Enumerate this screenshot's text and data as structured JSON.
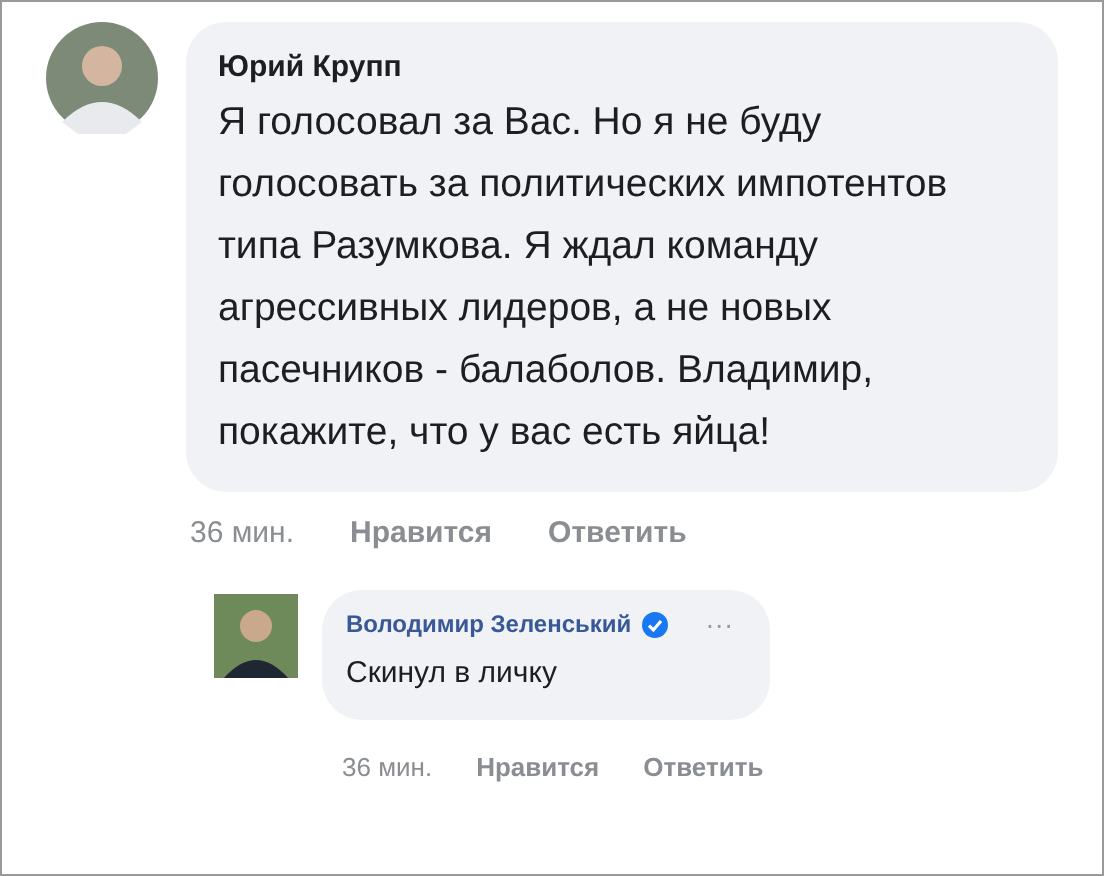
{
  "comment": {
    "author": "Юрий Крупп",
    "text": "Я голосовал за Вас. Но я не буду голосовать за политических импотентов типа Разумкова. Я ждал команду агрессивных лидеров, а не новых пасечников - балаболов. Владимир, покажите, что у вас есть яйца!",
    "actions": [
      "36 мин.",
      "Нравится",
      "Ответить"
    ]
  },
  "reply": {
    "author": "Володимир Зеленський",
    "verified": true,
    "more": "···",
    "text": "Скинул в личку",
    "actions": [
      "36 мин.",
      "Нравится",
      "Ответить"
    ]
  }
}
